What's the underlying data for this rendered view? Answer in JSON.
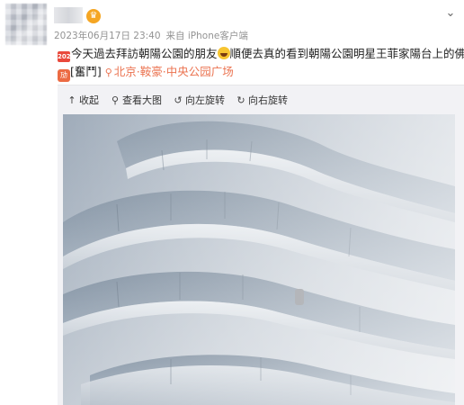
{
  "post": {
    "meta": {
      "timestamp": "2023年06月17日 23:40",
      "source": "来自 iPhone客户端"
    },
    "text_line1": {
      "emoji_2023": "2023",
      "part1": "今天過去拜訪朝陽公園的朋友",
      "part2": "順便去真的看到朝陽公園明星王菲家陽台上的佛像"
    },
    "text_line2": {
      "emoji_fight": "奋斗",
      "tag": "[奮鬥]",
      "location": "北京·鞍豪·中央公园广场"
    }
  },
  "toolbar": {
    "collapse_label": "收起",
    "view_large_label": "查看大图",
    "rotate_left_label": "向左旋转",
    "rotate_right_label": "向右旋转"
  },
  "icons": {
    "vip": "crown-badge-icon",
    "more": "chevron-down-icon",
    "collapse": "collapse-icon",
    "zoom": "magnifier-icon",
    "rotate_left": "rotate-left-icon",
    "rotate_right": "rotate-right-icon",
    "location": "location-pin-icon"
  },
  "colors": {
    "location_link": "#eb7350",
    "meta_text": "#939393",
    "card_bg": "#f2f2f5"
  }
}
